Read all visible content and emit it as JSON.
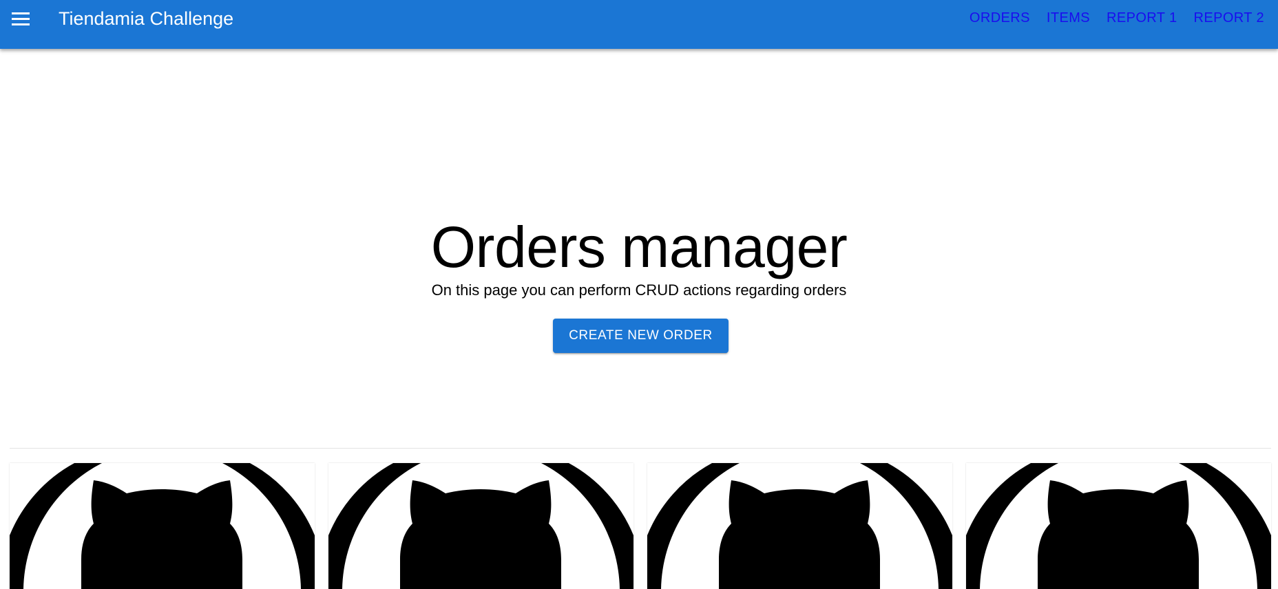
{
  "header": {
    "app_title": "Tiendamia Challenge",
    "menu_icon": "hamburger-menu-icon",
    "nav": [
      {
        "label": "ORDERS"
      },
      {
        "label": "ITEMS"
      },
      {
        "label": "REPORT 1"
      },
      {
        "label": "REPORT 2"
      }
    ]
  },
  "hero": {
    "title": "Orders manager",
    "subtitle": "On this page you can perform CRUD actions regarding orders",
    "create_button_label": "CREATE NEW ORDER"
  },
  "cards": [
    {
      "icon": "github-octocat-icon"
    },
    {
      "icon": "github-octocat-icon"
    },
    {
      "icon": "github-octocat-icon"
    },
    {
      "icon": "github-octocat-icon"
    }
  ],
  "colors": {
    "app_bar": "#1b76d4",
    "nav_link": "#1a0dee",
    "button": "#1b76d4"
  }
}
